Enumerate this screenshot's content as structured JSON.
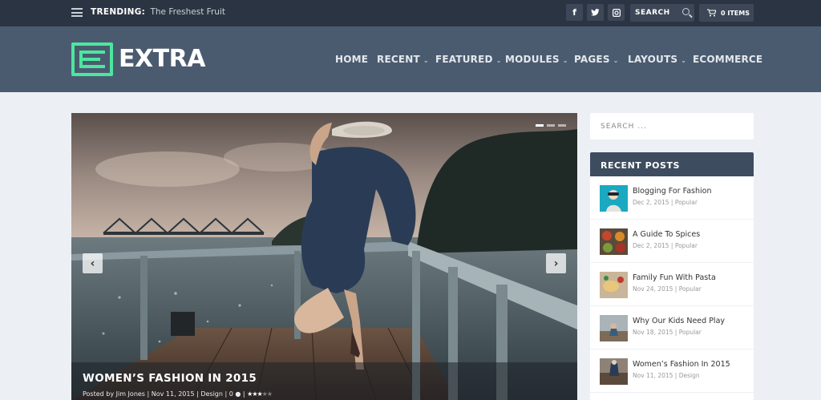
{
  "topbar": {
    "trending_label": "TRENDING:",
    "trending_value": "The Freshest Fruit",
    "social": [
      "f",
      "t",
      "i"
    ],
    "search_label": "SEARCH",
    "cart_label": "0 ITEMS"
  },
  "header": {
    "logo_text": "EXTRA",
    "nav": [
      {
        "label": "HOME",
        "dropdown": false
      },
      {
        "label": "RECENT",
        "dropdown": true
      },
      {
        "label": "FEATURED",
        "dropdown": true
      },
      {
        "label": "MODULES",
        "dropdown": true
      },
      {
        "label": "PAGES",
        "dropdown": true
      },
      {
        "label": "LAYOUTS",
        "dropdown": true
      },
      {
        "label": "ECOMMERCE",
        "dropdown": false
      }
    ],
    "accent_color": "#4ce6a0"
  },
  "slider": {
    "title": "WOMEN’S FASHION IN 2015",
    "meta_author_label": "Posted by",
    "meta_author": "Jim Jones",
    "meta_date": "Nov 11, 2015",
    "meta_category": "Design",
    "meta_comments": "0",
    "rating": 2.5,
    "rating_max": 5,
    "dots_total": 3,
    "dots_active": 1
  },
  "sidebar": {
    "search_placeholder": "SEARCH ...",
    "recent_title": "RECENT POSTS",
    "posts": [
      {
        "title": "Blogging For Fashion",
        "date": "Dec 2, 2015",
        "category": "Popular",
        "thumb": "fashion-portrait"
      },
      {
        "title": "A Guide To Spices",
        "date": "Dec 2, 2015",
        "category": "Popular",
        "thumb": "spices"
      },
      {
        "title": "Family Fun With Pasta",
        "date": "Nov 24, 2015",
        "category": "Popular",
        "thumb": "pasta"
      },
      {
        "title": "Why Our Kids Need Play",
        "date": "Nov 18, 2015",
        "category": "Popular",
        "thumb": "kids-play"
      },
      {
        "title": "Women’s Fashion In 2015",
        "date": "Nov 11, 2015",
        "category": "Design",
        "thumb": "fashion-pier"
      }
    ]
  }
}
